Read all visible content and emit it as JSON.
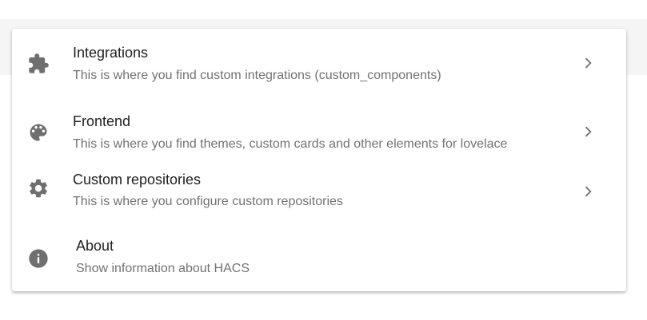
{
  "menu": {
    "items": [
      {
        "title": "Integrations",
        "description": "This is where you find custom integrations (custom_components)",
        "icon": "puzzle-icon"
      },
      {
        "title": "Frontend",
        "description": "This is where you find themes, custom cards and other elements for lovelace",
        "icon": "palette-icon"
      },
      {
        "title": "Custom repositories",
        "description": "This is where you configure custom repositories",
        "icon": "gear-icon"
      },
      {
        "title": "About",
        "description": "Show information about HACS",
        "icon": "info-icon"
      }
    ]
  },
  "colors": {
    "icon": "#6f6f6f",
    "title": "#212121",
    "description": "#727272",
    "chevron": "#727272"
  }
}
